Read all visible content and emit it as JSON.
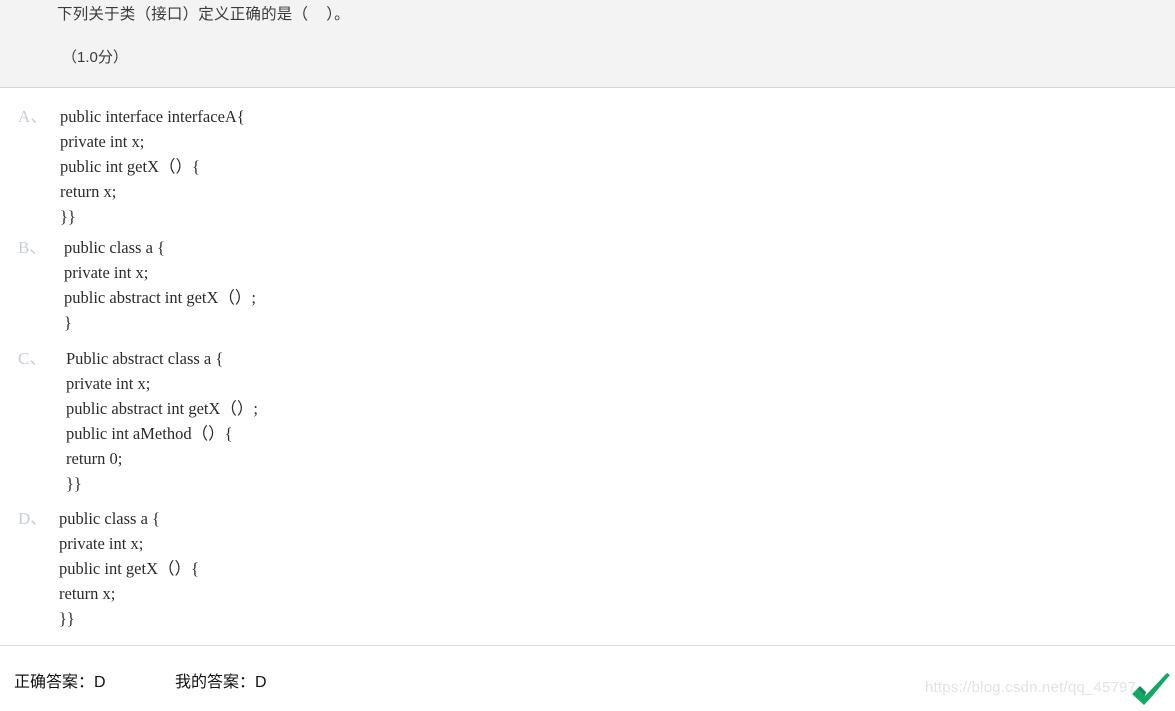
{
  "question": {
    "stem": "下列关于类（接口）定义正确的是（    ）。",
    "score": "（1.0分）"
  },
  "options": [
    {
      "letter": "A、",
      "lines": [
        "public interface interfaceA{",
        "private int x;",
        "public int getX（）{",
        "return x;",
        "}}"
      ]
    },
    {
      "letter": "B、",
      "lines": [
        "public class a {",
        "private int x;",
        "public abstract int getX（）;",
        "}"
      ]
    },
    {
      "letter": "C、",
      "lines": [
        "Public abstract class a {",
        "private int x;",
        "public abstract int getX（）;",
        "public int aMethod（）{",
        "return 0;",
        "}}"
      ]
    },
    {
      "letter": "D、",
      "lines": [
        "public class a {",
        "private int x;",
        "public int getX（）{",
        "return x;",
        "}}"
      ]
    }
  ],
  "footer": {
    "correct_answer_label": "正确答案：",
    "correct_answer_value": "D",
    "my_answer_label": "我的答案：",
    "my_answer_value": "D"
  },
  "watermark": {
    "url": "https://blog.csdn.net/qq_45797",
    "logo_color": "#14a866",
    "logo_name": "csdn-logo"
  },
  "colors": {
    "header_bg": "#f3f3f3",
    "body_bg": "#ffffff",
    "divider": "#dcdcdc",
    "option_letter": "#c9ced6",
    "code_text": "#2b2b2b",
    "stem_text": "#3b3b3b"
  },
  "layout": {
    "option_tops": [
      16,
      147,
      258,
      418
    ],
    "option_code_lefts": [
      60,
      64,
      66,
      59
    ]
  }
}
